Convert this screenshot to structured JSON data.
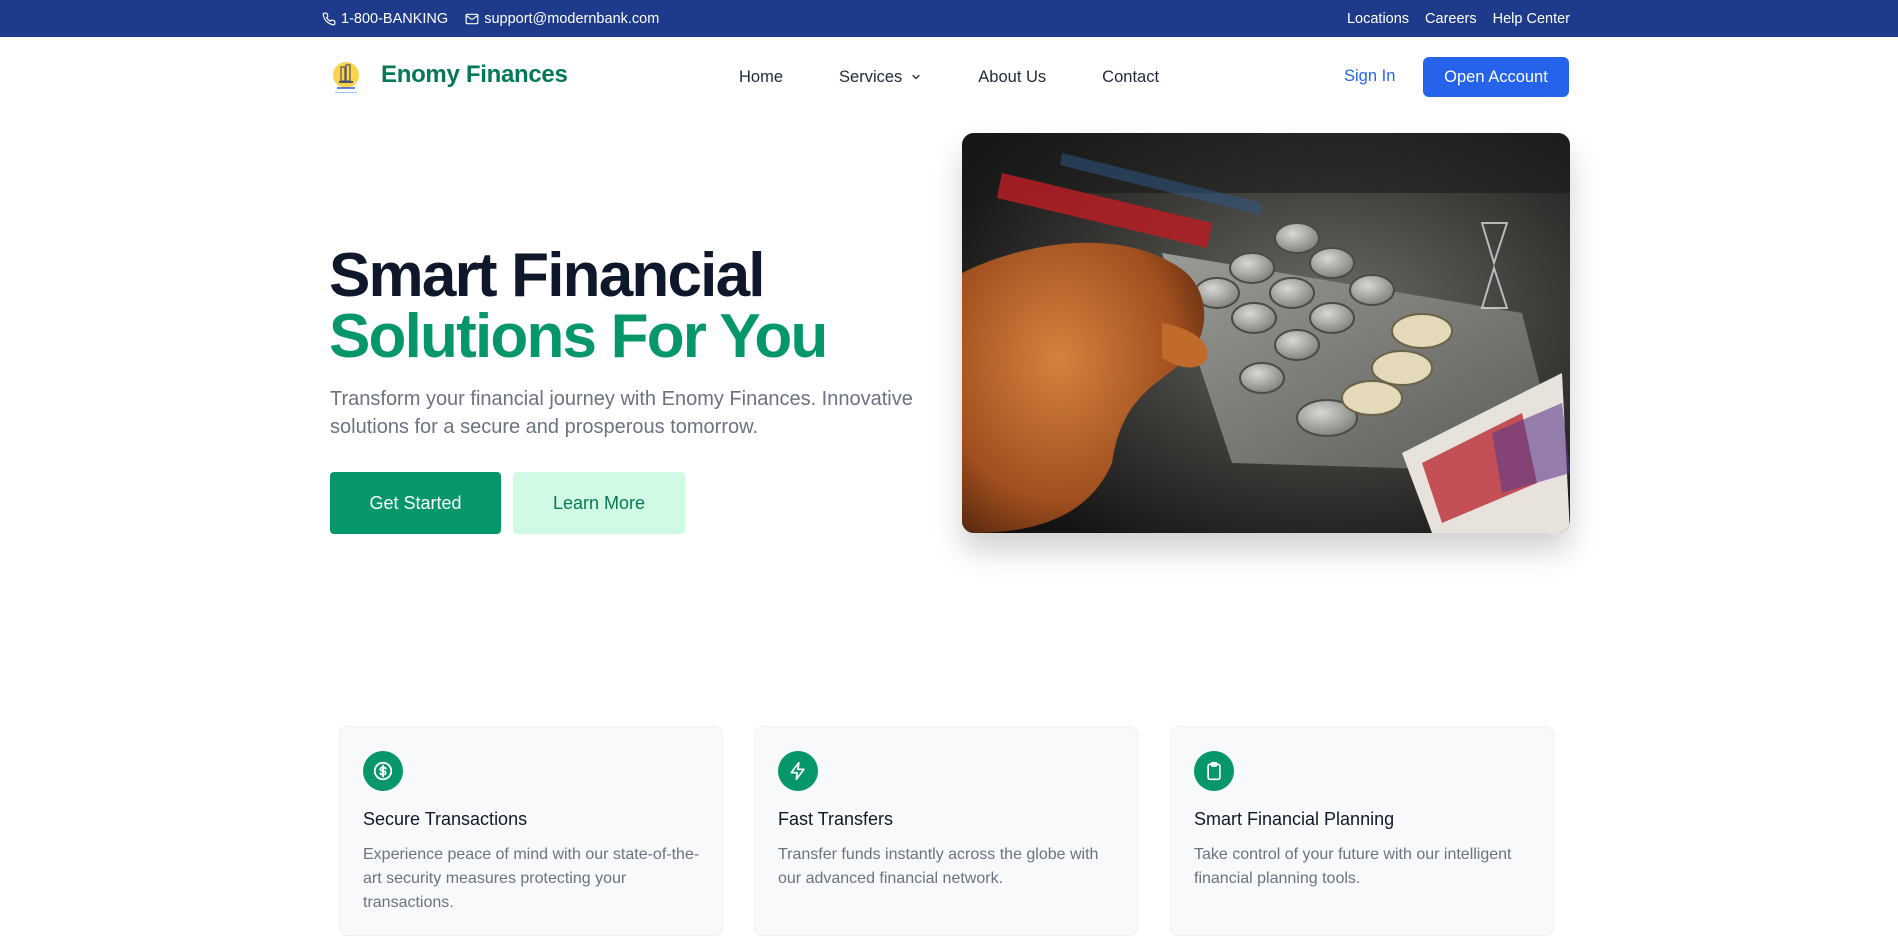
{
  "topbar": {
    "phone": "1-800-BANKING",
    "email": "support@modernbank.com",
    "links": [
      "Locations",
      "Careers",
      "Help Center"
    ]
  },
  "header": {
    "brand": "Enomy Finances",
    "nav": [
      "Home",
      "Services",
      "About Us",
      "Contact"
    ],
    "sign_in": "Sign In",
    "open_account": "Open Account"
  },
  "hero": {
    "title_line1": "Smart Financial",
    "title_line2": "Solutions For You",
    "subtitle": "Transform your financial journey with Enomy Finances. Innovative solutions for a secure and prosperous tomorrow.",
    "primary_cta": "Get Started",
    "secondary_cta": "Learn More"
  },
  "features": [
    {
      "icon": "dollar-circle-icon",
      "title": "Secure Transactions",
      "description": "Experience peace of mind with our state-of-the-art security measures protecting your transactions."
    },
    {
      "icon": "lightning-icon",
      "title": "Fast Transfers",
      "description": "Transfer funds instantly across the globe with our advanced financial network."
    },
    {
      "icon": "clipboard-icon",
      "title": "Smart Financial Planning",
      "description": "Take control of your future with our intelligent financial planning tools."
    }
  ],
  "colors": {
    "topbar": "#1e3a8a",
    "brand_green": "#059669",
    "accent_blue": "#2563eb",
    "secondary_bg": "#d1fae5"
  }
}
